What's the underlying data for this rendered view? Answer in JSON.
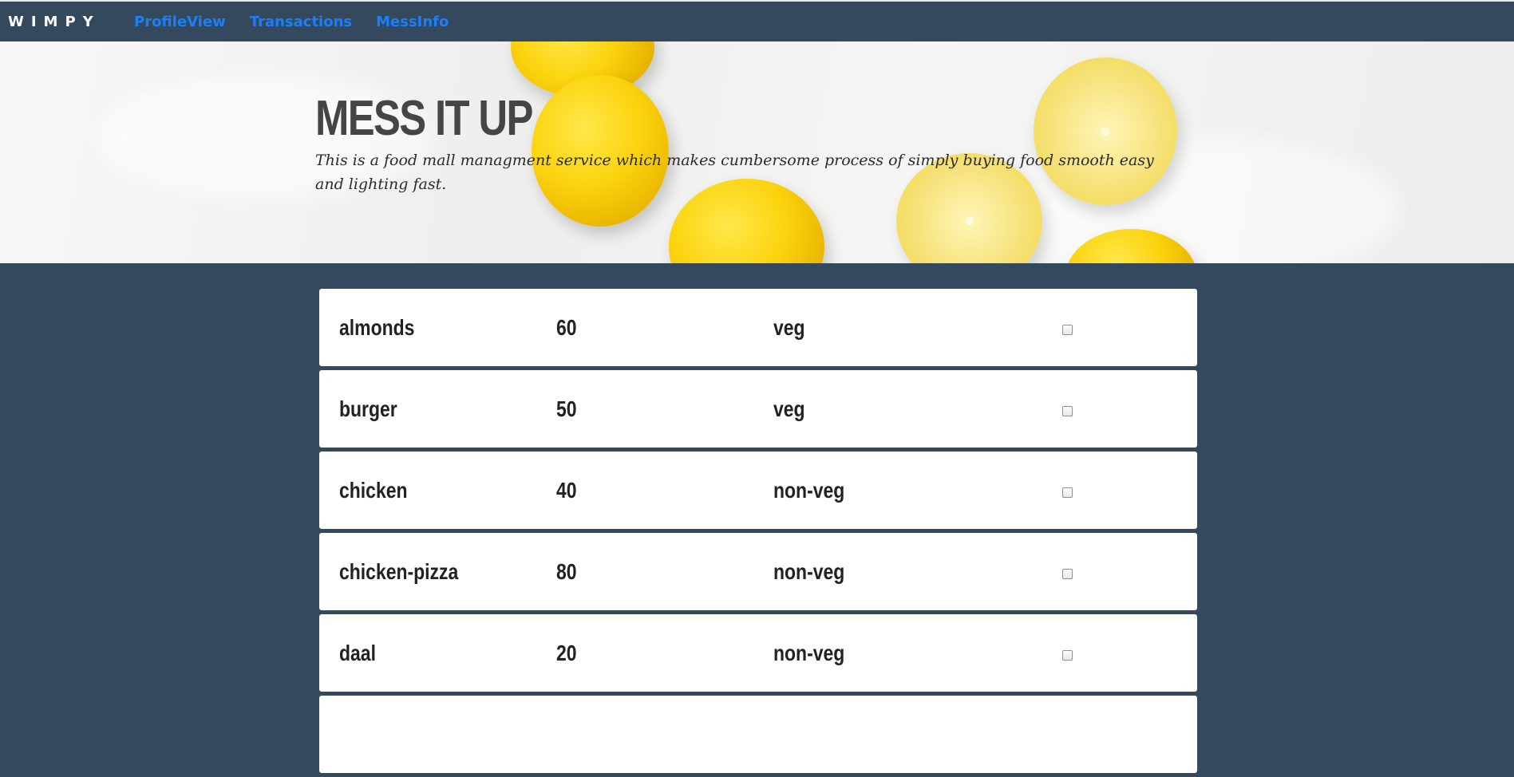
{
  "navbar": {
    "brand": "WIMPY",
    "links": [
      "ProfileView",
      "Transactions",
      "MessInfo"
    ]
  },
  "hero": {
    "title": "MESS IT UP",
    "subtitle": "This is a food mall managment service which makes cumbersome process of simply buying food smooth easy and lighting fast."
  },
  "menu": {
    "items": [
      {
        "name": "almonds",
        "price": "60",
        "type": "veg",
        "checked": false
      },
      {
        "name": "burger",
        "price": "50",
        "type": "veg",
        "checked": false
      },
      {
        "name": "chicken",
        "price": "40",
        "type": "non-veg",
        "checked": false
      },
      {
        "name": "chicken-pizza",
        "price": "80",
        "type": "non-veg",
        "checked": false
      },
      {
        "name": "daal",
        "price": "20",
        "type": "non-veg",
        "checked": false
      }
    ]
  },
  "colors": {
    "background": "#34495e",
    "nav_link": "#1a7ffb",
    "card": "#ffffff",
    "lemon": "#fbd30d"
  }
}
